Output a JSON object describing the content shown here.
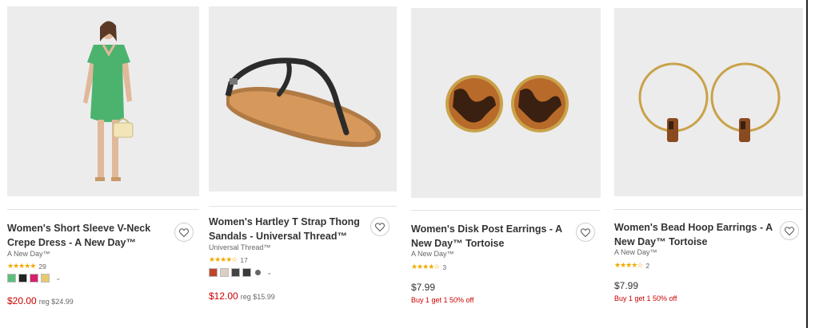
{
  "products": [
    {
      "title": "Women's Short Sleeve V-Neck Crepe Dress - A New Day™",
      "brand": "A New Day™",
      "stars": "★★★★★",
      "rating_count": "29",
      "swatch_colors": [
        "#5bbf7c",
        "#222222",
        "#d61f6b",
        "#e8c96e"
      ],
      "sale_price": "$20.00",
      "reg_price": "reg $24.99"
    },
    {
      "title": "Women's Hartley T Strap Thong Sandals - Universal Thread™",
      "brand": "Universal Thread™",
      "stars": "★★★★☆",
      "rating_count": "17",
      "swatch_colors": [
        "#c0442b",
        "#d9cfc4",
        "#444444",
        "#3a3a3a"
      ],
      "sale_price": "$12.00",
      "reg_price": "reg $15.99"
    },
    {
      "title": "Women's Disk Post Earrings - A New Day™ Tortoise",
      "brand": "A New Day™",
      "stars": "★★★★☆",
      "rating_count": "3",
      "price": "$7.99",
      "promo": "Buy 1 get 1 50% off"
    },
    {
      "title": "Women's Bead Hoop Earrings - A New Day™ Tortoise",
      "brand": "A New Day™",
      "stars": "★★★★☆",
      "rating_count": "2",
      "price": "$7.99",
      "promo": "Buy 1 get 1 50% off"
    }
  ],
  "icons": {
    "heart": "heart-icon",
    "chevron": "chevron-down-icon",
    "more": "more-colors-icon"
  },
  "colors": {
    "sale_red": "#cc0000",
    "star": "#f2a900"
  }
}
